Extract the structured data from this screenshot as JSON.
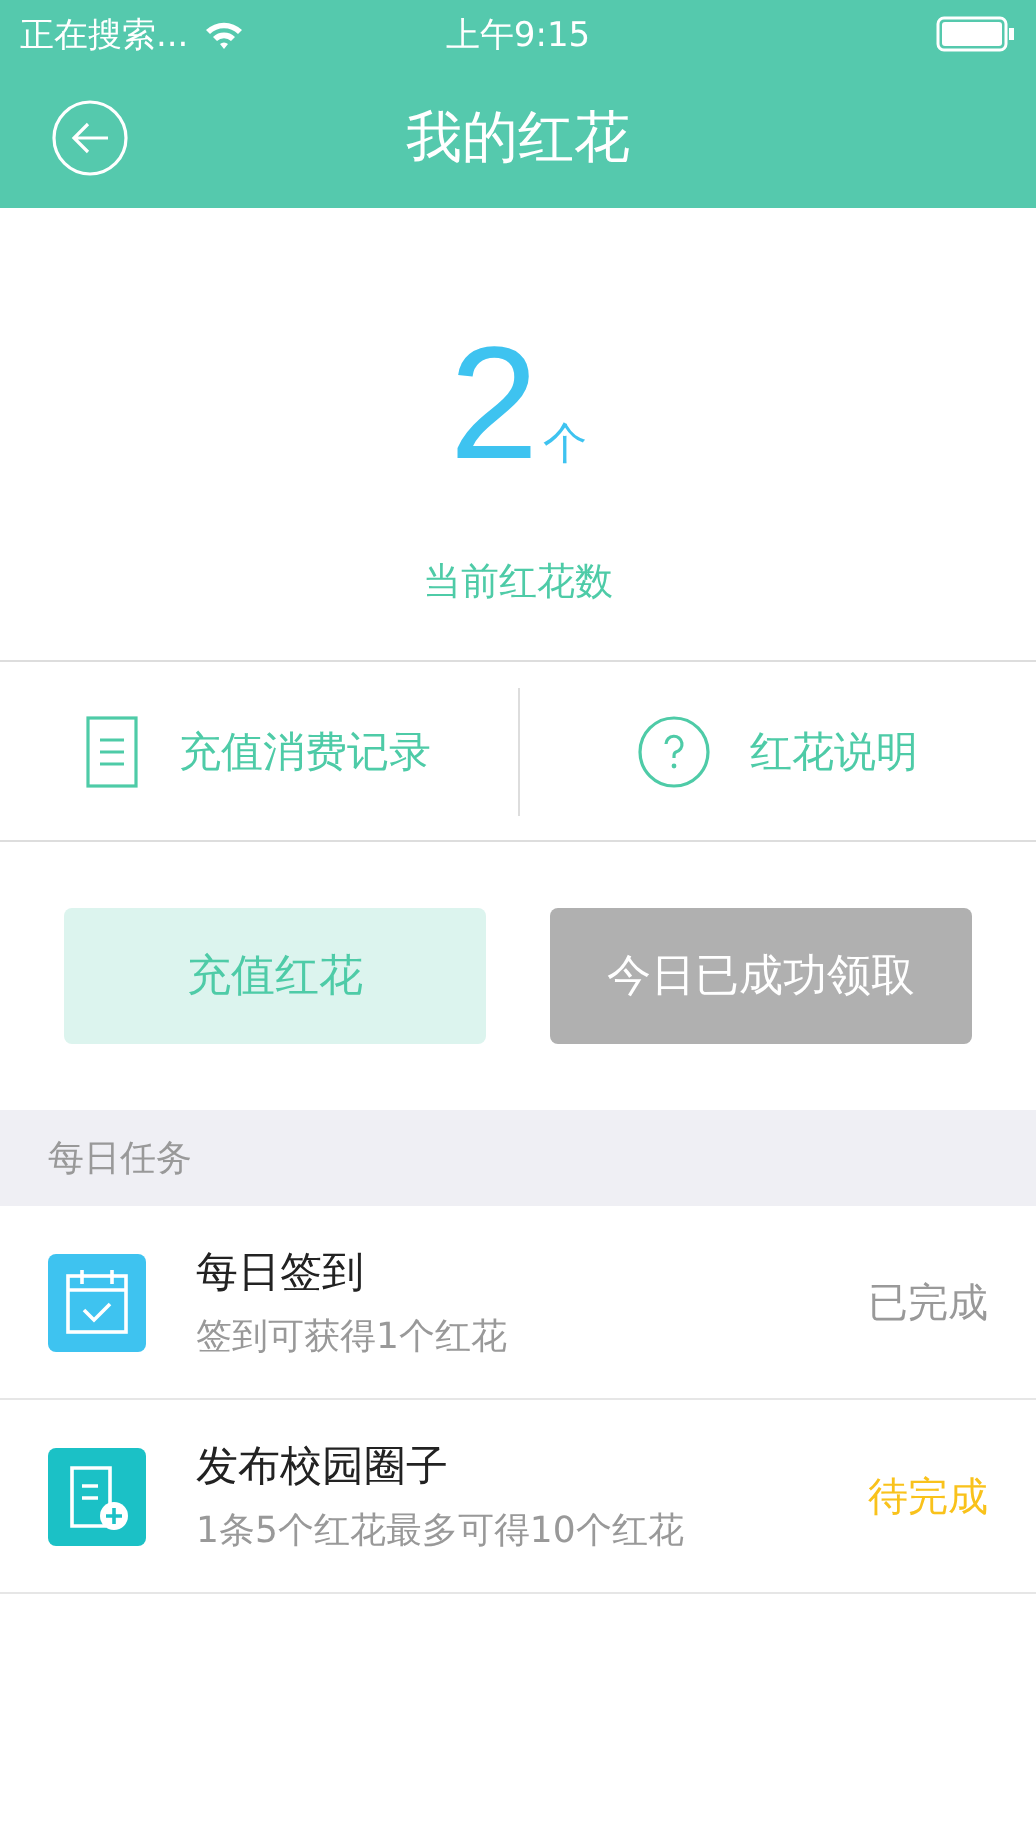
{
  "status_bar": {
    "carrier": "正在搜索...",
    "time": "上午9:15"
  },
  "header": {
    "title": "我的红花"
  },
  "count": {
    "value": "2",
    "unit": "个",
    "label": "当前红花数"
  },
  "links": [
    {
      "kind": "records",
      "label": "充值消费记录"
    },
    {
      "kind": "help",
      "label": "红花说明"
    }
  ],
  "buttons": [
    {
      "label": "充值红花",
      "disabled": false
    },
    {
      "label": "今日已成功领取",
      "disabled": true
    }
  ],
  "section": {
    "title": "每日任务"
  },
  "tasks": [
    {
      "kind": "calendar",
      "title": "每日签到",
      "subtitle": "签到可获得1个红花",
      "status": "已完成",
      "done": true
    },
    {
      "kind": "post",
      "title": "发布校园圈子",
      "subtitle": "1条5个红花最多可得10个红花",
      "status": "待完成",
      "done": false
    }
  ]
}
